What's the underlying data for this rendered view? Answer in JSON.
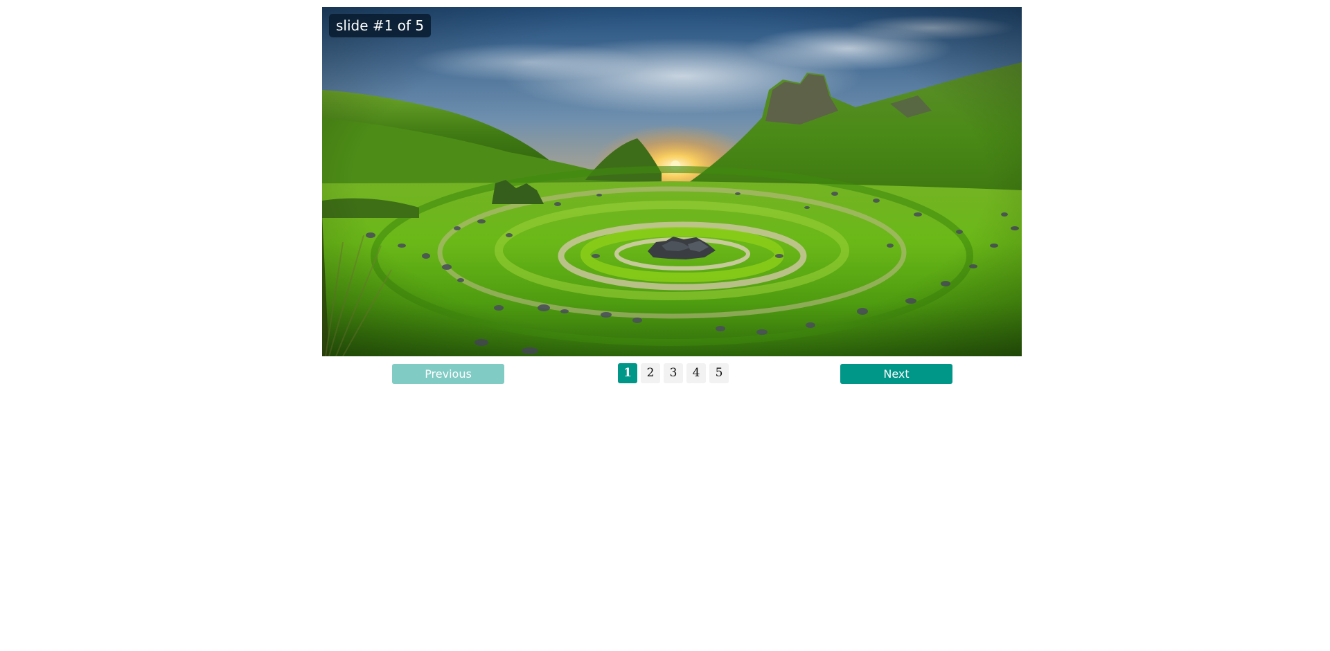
{
  "slider": {
    "counter": "slide #1 of 5",
    "current": 1,
    "total": 5
  },
  "controls": {
    "previous_label": "Previous",
    "next_label": "Next",
    "pages": [
      "1",
      "2",
      "3",
      "4",
      "5"
    ],
    "active_page": "1"
  },
  "colors": {
    "accent": "#009688",
    "accent_disabled": "#80cbc4",
    "counter_bg": "#091c30"
  }
}
